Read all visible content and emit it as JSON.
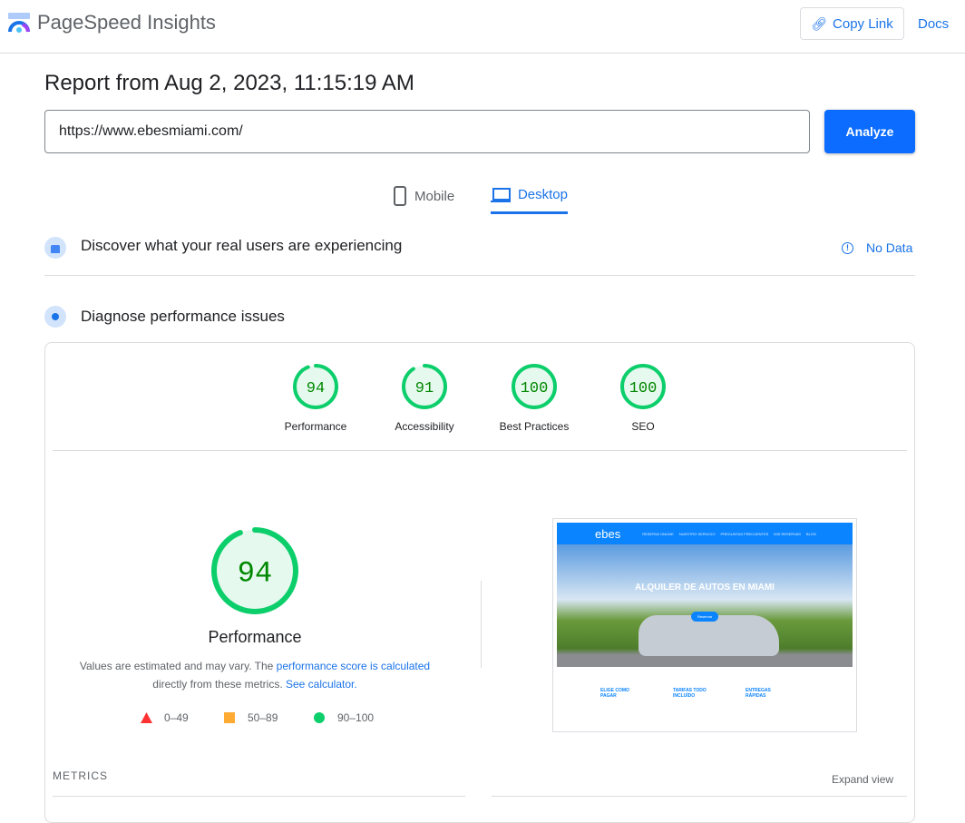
{
  "header": {
    "app_title": "PageSpeed Insights",
    "copy_link": "Copy Link",
    "docs": "Docs"
  },
  "report": {
    "title": "Report from Aug 2, 2023, 11:15:19 AM",
    "url_value": "https://www.ebesmiami.com/",
    "analyze": "Analyze"
  },
  "tabs": [
    {
      "label": "Mobile",
      "icon": "phone-icon"
    },
    {
      "label": "Desktop",
      "icon": "laptop-icon",
      "active": true
    }
  ],
  "field_section": {
    "title": "Discover what your real users are experiencing",
    "status": "No Data"
  },
  "lab_section": {
    "title": "Diagnose performance issues"
  },
  "scores": [
    {
      "label": "Performance",
      "value": 94
    },
    {
      "label": "Accessibility",
      "value": 91
    },
    {
      "label": "Best Practices",
      "value": 100
    },
    {
      "label": "SEO",
      "value": 100
    }
  ],
  "main_score": {
    "value": 94,
    "label": "Performance",
    "note_prefix": "Values are estimated and may vary. The ",
    "note_link1": "performance score is calculated",
    "note_mid": "directly from these metrics. ",
    "note_link2": "See calculator."
  },
  "legend": [
    {
      "range": "0–49",
      "color": "#ff3333",
      "shape": "triangle"
    },
    {
      "range": "50–89",
      "color": "#ffaa33",
      "shape": "square"
    },
    {
      "range": "90–100",
      "color": "#0cce6b",
      "shape": "circle"
    }
  ],
  "thumbnail": {
    "brand": "ebes",
    "nav": [
      "RESERVA ONLINE",
      "NUESTRO SERVICIO",
      "PREGUNTAS FRECUENTES",
      "MIS RESERVAS",
      "BLOG"
    ],
    "headline": "ALQUILER DE AUTOS EN MIAMI",
    "cta": "Reservar",
    "features": [
      "ELIGE COMO PAGAR",
      "TARIFAS TODO INCLUÍDO",
      "ENTREGAS RÁPIDAS"
    ]
  },
  "metrics": {
    "title": "METRICS",
    "expand": "Expand view"
  },
  "colors": {
    "accent": "#1a73e8",
    "pass": "#0cce6b",
    "pass_text": "#008800",
    "pass_bg": "#e6f9ee"
  }
}
